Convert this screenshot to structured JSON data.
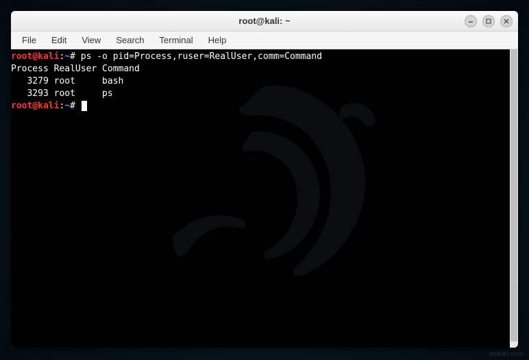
{
  "window": {
    "title": "root@kali: ~"
  },
  "menubar": {
    "items": [
      "File",
      "Edit",
      "View",
      "Search",
      "Terminal",
      "Help"
    ]
  },
  "terminal": {
    "prompt_user": "root@kali",
    "prompt_sep1": ":",
    "prompt_path": "~",
    "prompt_sep2": "#",
    "line1_cmd": "ps -o pid=Process,ruser=RealUser,comm=Command",
    "output_header": "Process RealUser Command",
    "output_rows": [
      {
        "pid": "3279",
        "user": "root",
        "comm": "bash"
      },
      {
        "pid": "3293",
        "user": "root",
        "comm": "ps"
      }
    ],
    "output_row1": "   3279 root     bash",
    "output_row2": "   3293 root     ps"
  },
  "watermark": "wskdn.com"
}
